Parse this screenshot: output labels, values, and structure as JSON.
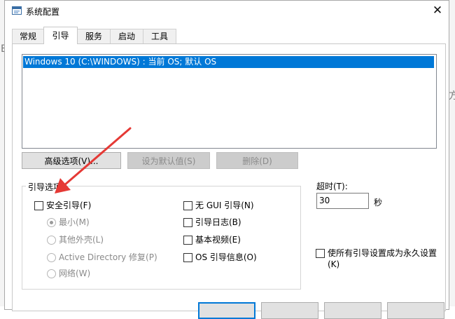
{
  "window": {
    "title": "系统配置",
    "close_glyph": "✕"
  },
  "background": {
    "left_char": "B",
    "right_char": "方"
  },
  "tabs": [
    {
      "label": "常规",
      "active": false
    },
    {
      "label": "引导",
      "active": true
    },
    {
      "label": "服务",
      "active": false
    },
    {
      "label": "启动",
      "active": false
    },
    {
      "label": "工具",
      "active": false
    }
  ],
  "os_list": {
    "items": [
      "Windows 10 (C:\\WINDOWS) : 当前 OS; 默认 OS"
    ],
    "selected_index": 0
  },
  "buttons": {
    "advanced": "高级选项(V)...",
    "set_default": "设为默认值(S)",
    "delete": "删除(D)"
  },
  "boot_options": {
    "group_label": "引导选项",
    "safe_boot": "安全引导(F)",
    "minimal": "最小(M)",
    "alternate_shell": "其他外壳(L)",
    "ad_repair": "Active Directory 修复(P)",
    "network": "网络(W)",
    "no_gui": "无 GUI 引导(N)",
    "boot_log": "引导日志(B)",
    "base_video": "基本视频(E)",
    "os_boot_info": "OS 引导信息(O)"
  },
  "timeout": {
    "label": "超时(T):",
    "value": "30",
    "unit": "秒"
  },
  "make_permanent": "使所有引导设置成为永久设置(K)",
  "colors": {
    "selection": "#0078d7",
    "annotation_arrow": "#e53935"
  },
  "icons": {
    "app": "msconfig-icon",
    "close": "close-icon",
    "annotation": "red-arrow-annotation"
  }
}
